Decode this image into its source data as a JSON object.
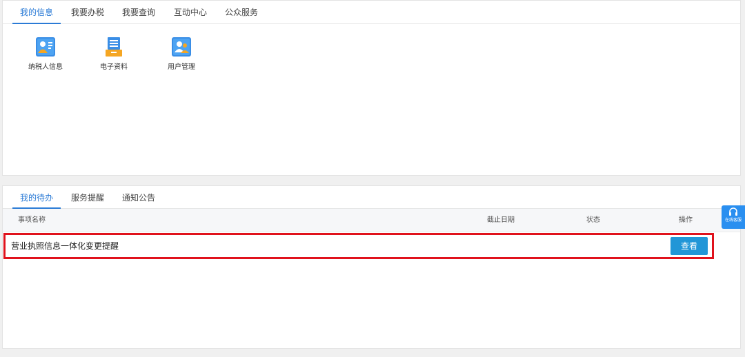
{
  "top_panel": {
    "tabs": [
      "我的信息",
      "我要办税",
      "我要查询",
      "互动中心",
      "公众服务"
    ],
    "active_tab": "我的信息",
    "functions": [
      {
        "label": "纳税人信息",
        "icon": "taxpayer-card-icon"
      },
      {
        "label": "电子资料",
        "icon": "document-stack-icon"
      },
      {
        "label": "用户管理",
        "icon": "users-icon"
      }
    ]
  },
  "bottom_panel": {
    "tabs": [
      "我的待办",
      "服务提醒",
      "通知公告"
    ],
    "active_tab": "我的待办",
    "table": {
      "headers": [
        "事项名称",
        "截止日期",
        "状态",
        "操作"
      ],
      "rows": [
        {
          "name": "营业执照信息一体化变更提醒",
          "deadline": "",
          "status": "",
          "action": "查看"
        }
      ]
    }
  },
  "floating_service": {
    "label": "在线客服",
    "icon": "headset-icon"
  },
  "colors": {
    "accent": "#2b7bd6",
    "button": "#2196d7",
    "highlight_border": "#e0121c",
    "icon_blue": "#3a8ee6",
    "icon_orange": "#f5a623"
  }
}
